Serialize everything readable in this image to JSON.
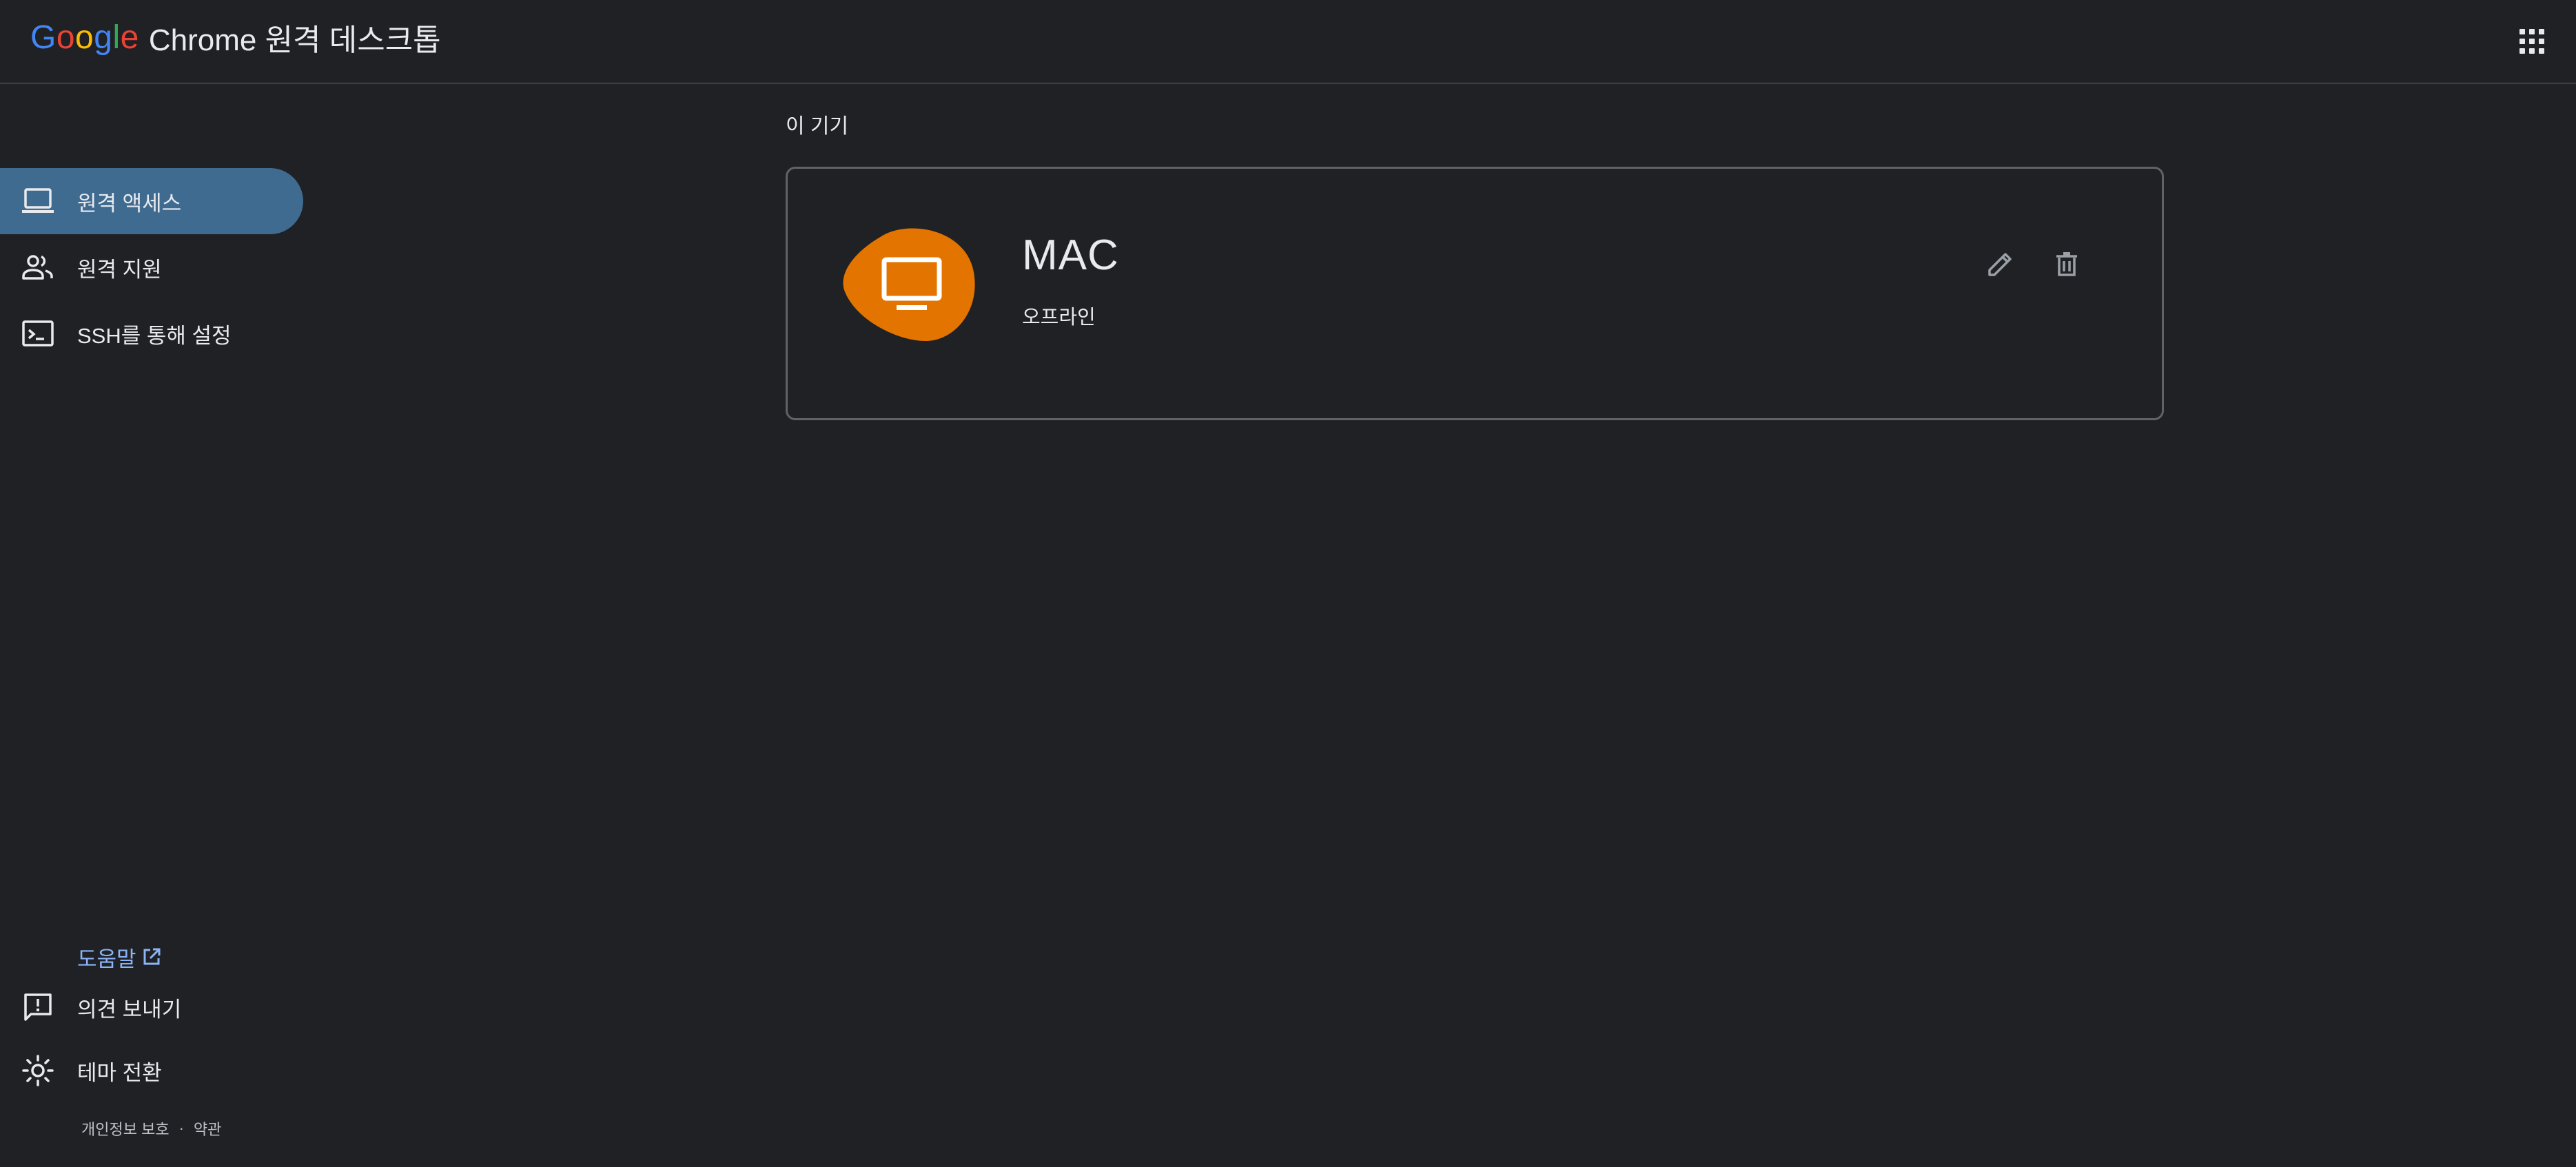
{
  "header": {
    "logo_text": "Google",
    "app_title": "Chrome 원격 데스크톱",
    "apps_icon": "apps-grid-icon"
  },
  "sidebar": {
    "items": [
      {
        "label": "원격 액세스",
        "icon": "laptop-icon",
        "active": true
      },
      {
        "label": "원격 지원",
        "icon": "people-icon",
        "active": false
      },
      {
        "label": "SSH를 통해 설정",
        "icon": "terminal-icon",
        "active": false
      }
    ],
    "help": {
      "label": "도움말",
      "icon": "open-in-new-icon"
    },
    "bottom_items": [
      {
        "label": "의견 보내기",
        "icon": "feedback-icon"
      },
      {
        "label": "테마 전환",
        "icon": "brightness-icon"
      }
    ],
    "footer": {
      "privacy": "개인정보 보호",
      "separator": "·",
      "terms": "약관"
    }
  },
  "main": {
    "section_title": "이 기기",
    "device": {
      "name": "MAC",
      "status": "오프라인",
      "icon": "monitor-icon",
      "actions": [
        {
          "name": "edit",
          "icon": "pencil-icon"
        },
        {
          "name": "delete",
          "icon": "trash-icon"
        }
      ]
    }
  },
  "colors": {
    "background": "#202124",
    "active_nav": "#3f6b91",
    "link": "#8ab4f8",
    "device_accent": "#e37400",
    "card_border": "#5f6368"
  }
}
